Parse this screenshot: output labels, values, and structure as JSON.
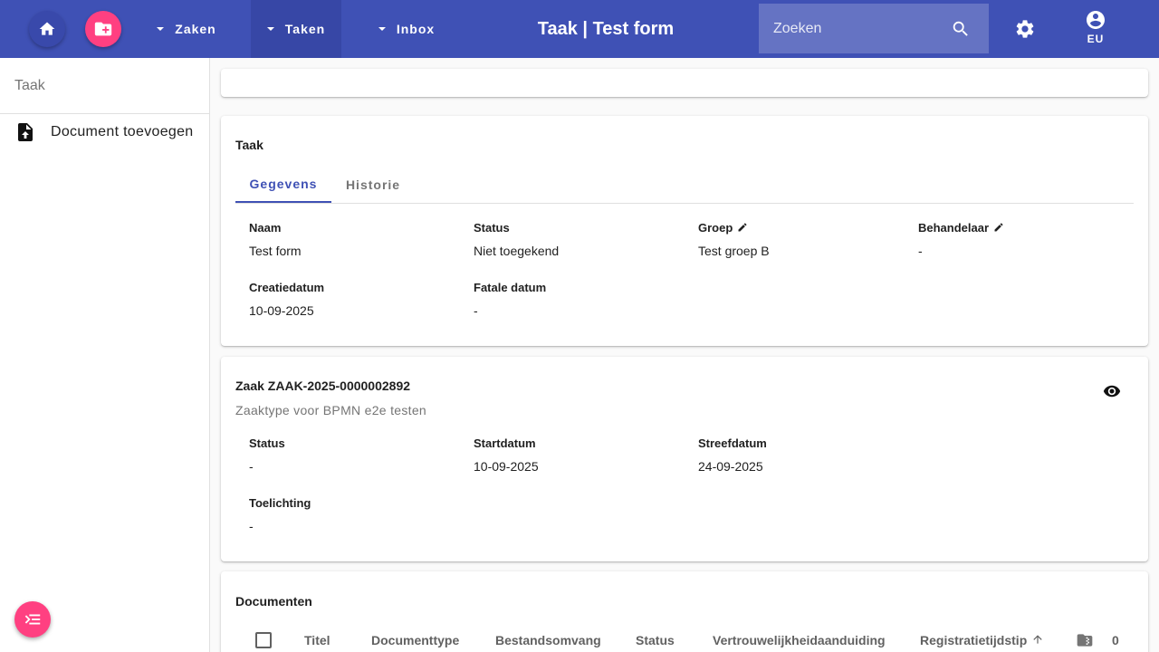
{
  "topbar": {
    "home_icon": "home-icon",
    "new_case_icon": "folder-plus-icon",
    "menus": [
      {
        "label": "Zaken"
      },
      {
        "label": "Taken"
      },
      {
        "label": "Inbox"
      }
    ],
    "title": "Taak | Test form",
    "search": {
      "placeholder": "Zoeken",
      "value": ""
    },
    "account_label": "EU",
    "colors": {
      "primary": "#3f51b5",
      "accent": "#ff4081"
    }
  },
  "sidebar": {
    "header": "Taak",
    "items": [
      {
        "label": "Document toevoegen",
        "icon": "file-upload-icon"
      }
    ]
  },
  "taak": {
    "title": "Taak",
    "tabs": [
      {
        "label": "Gegevens",
        "active": true
      },
      {
        "label": "Historie",
        "active": false
      }
    ],
    "fields": [
      {
        "label": "Naam",
        "value": "Test form"
      },
      {
        "label": "Status",
        "value": "Niet toegekend"
      },
      {
        "label": "Groep",
        "value": "Test groep B",
        "editable": true
      },
      {
        "label": "Behandelaar",
        "value": "-",
        "editable": true
      },
      {
        "label": "Creatiedatum",
        "value": "10-09-2025"
      },
      {
        "label": "Fatale datum",
        "value": "-"
      }
    ]
  },
  "zaak": {
    "title": "Zaak ZAAK-2025-0000002892",
    "subtitle": "Zaaktype voor BPMN e2e testen",
    "fields": [
      {
        "label": "Status",
        "value": "-"
      },
      {
        "label": "Startdatum",
        "value": "10-09-2025"
      },
      {
        "label": "Streefdatum",
        "value": "24-09-2025"
      },
      {
        "label": "Toelichting",
        "value": "-"
      }
    ]
  },
  "documenten": {
    "title": "Documenten",
    "columns": [
      "Titel",
      "Documenttype",
      "Bestandsomvang",
      "Status",
      "Vertrouwelijkheidaanduiding",
      "Registratietijdstip"
    ],
    "count": "0"
  }
}
